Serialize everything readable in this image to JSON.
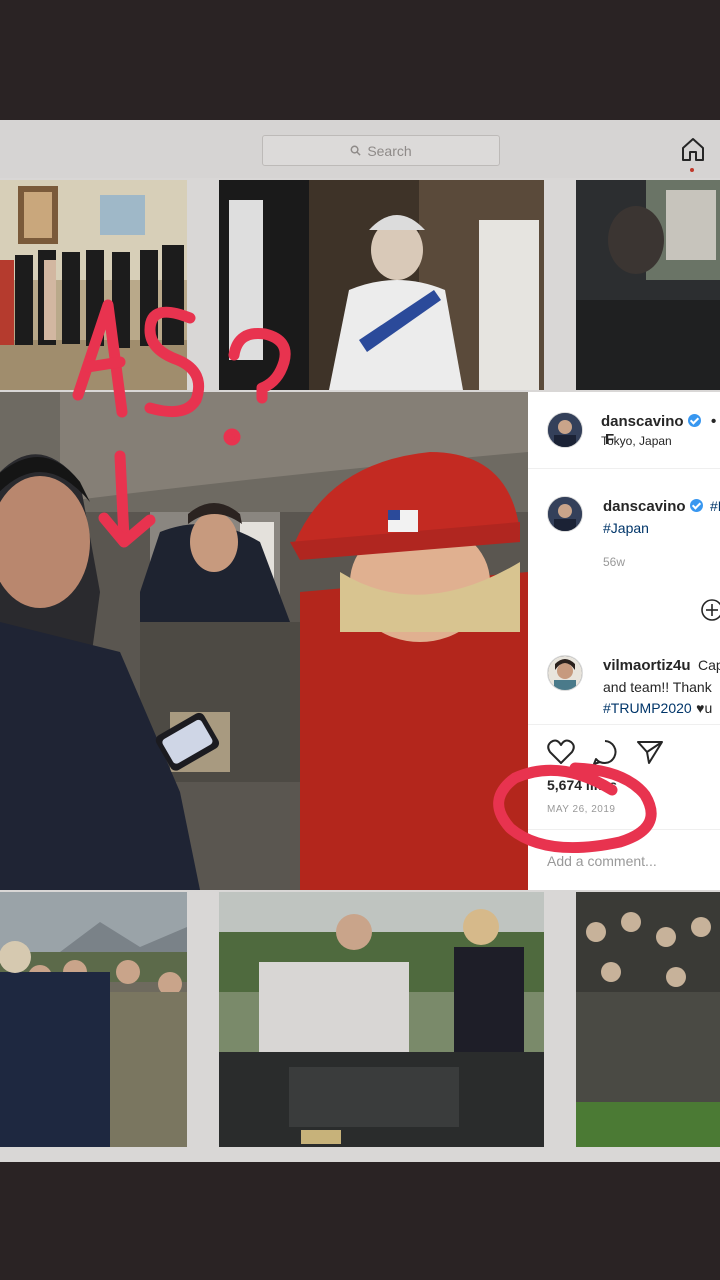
{
  "search": {
    "placeholder": "Search"
  },
  "post": {
    "header": {
      "username": "danscavino",
      "dot": "•",
      "follow": "F",
      "location": "Tokyo, Japan"
    },
    "caption": {
      "username": "danscavino",
      "text_start": "#M",
      "hashtag": "#Japan",
      "age": "56w"
    },
    "comment": {
      "username": "vilmaortiz4u",
      "line1": "Cap",
      "line2": "and team!! Thank",
      "line3_tag": "#TRUMP2020",
      "line3_heart": "♥u"
    },
    "likes": "5,674 likes",
    "date": "MAY 26, 2019",
    "add_comment": "Add a comment..."
  },
  "annotation": {
    "text": "AS?",
    "color": "#e8334f"
  },
  "icons": [
    "search-icon",
    "home-icon",
    "heart-icon",
    "comment-icon",
    "share-icon",
    "add-icon",
    "verified-badge-icon"
  ]
}
